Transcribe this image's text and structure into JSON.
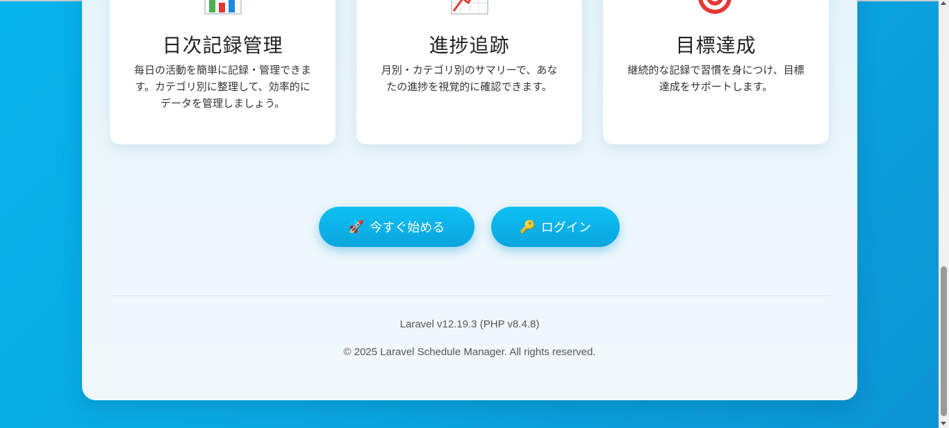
{
  "features": [
    {
      "icon": "bar-chart-icon",
      "title": "日次記録管理",
      "description": "毎日の活動を簡単に記録・管理できます。カテゴリ別に整理して、効率的にデータを管理しましょう。"
    },
    {
      "icon": "trend-chart-icon",
      "title": "進捗追跡",
      "description": "月別・カテゴリ別のサマリーで、あなたの進捗を視覚的に確認できます。"
    },
    {
      "icon": "target-icon",
      "title": "目標達成",
      "description": "継続的な記録で習慣を身につけ、目標達成をサポートします。"
    }
  ],
  "actions": {
    "start": {
      "icon": "🚀",
      "label": "今すぐ始める"
    },
    "login": {
      "icon": "🔑",
      "label": "ログイン"
    }
  },
  "footer": {
    "version": "Laravel v12.19.3 (PHP v8.4.8)",
    "copyright": "© 2025 Laravel Schedule Manager. All rights reserved."
  },
  "colors": {
    "background": "#0aa8e2",
    "button": "#0ab4ea",
    "panel": "#eaf5fb"
  }
}
